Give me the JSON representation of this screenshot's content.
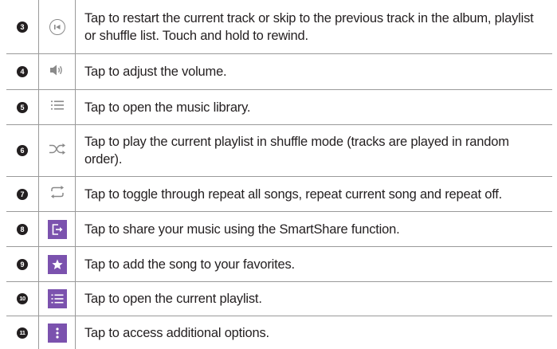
{
  "rows": [
    {
      "number": "3",
      "icon": "skip-previous-icon",
      "description": "Tap to restart the current track or skip to the previous track in the album, playlist or shuffle list. Touch and hold to rewind."
    },
    {
      "number": "4",
      "icon": "volume-icon",
      "description": "Tap to adjust the volume."
    },
    {
      "number": "5",
      "icon": "music-library-icon",
      "description": "Tap to open the music library."
    },
    {
      "number": "6",
      "icon": "shuffle-icon",
      "description": "Tap to play the current playlist in shuffle mode (tracks are played in random order)."
    },
    {
      "number": "7",
      "icon": "repeat-icon",
      "description": "Tap to toggle through repeat all songs, repeat current song and repeat off."
    },
    {
      "number": "8",
      "icon": "smartshare-icon",
      "description": "Tap to share your music using the SmartShare function."
    },
    {
      "number": "9",
      "icon": "favorite-star-icon",
      "description": "Tap to add the song to your favorites."
    },
    {
      "number": "10",
      "icon": "playlist-icon",
      "description": "Tap to open the current playlist."
    },
    {
      "number": "11",
      "icon": "more-options-icon",
      "description": "Tap to access additional options."
    }
  ],
  "colors": {
    "icon_accent": "#7b52ae",
    "icon_grey": "#8a8a8a",
    "rule": "#9a9a9a",
    "text": "#231f20"
  }
}
